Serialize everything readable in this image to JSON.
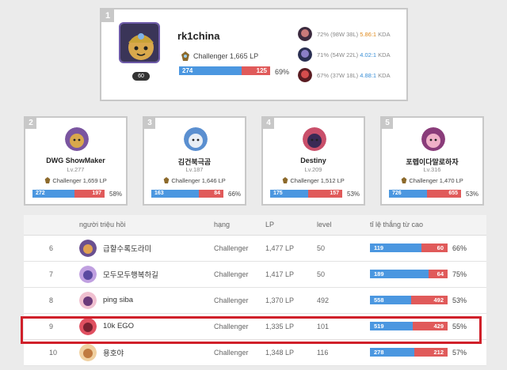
{
  "top1": {
    "rank": "1",
    "name": "rk1china",
    "level": "60",
    "tier": "Challenger",
    "lp": "1,665 LP",
    "wins": "274",
    "losses": "125",
    "win_fraction": 0.69,
    "winrate": "69%",
    "champions": [
      {
        "winrate": "72%",
        "record": "(98W 38L)",
        "kda": "5.86:1",
        "kda_label": "KDA",
        "kda_color": "#e08a1c"
      },
      {
        "winrate": "71%",
        "record": "(54W 22L)",
        "kda": "4.02:1",
        "kda_label": "KDA",
        "kda_color": "#3a8fd6"
      },
      {
        "winrate": "67%",
        "record": "(37W 18L)",
        "kda": "4.88:1",
        "kda_label": "KDA",
        "kda_color": "#3a8fd6"
      }
    ]
  },
  "top_cards": [
    {
      "rank": "2",
      "name": "DWG ShowMaker",
      "level": "Lv.277",
      "tier": "Challenger",
      "lp": "1,659 LP",
      "wins": "272",
      "losses": "197",
      "win_fraction": 0.58,
      "winrate": "58%"
    },
    {
      "rank": "3",
      "name": "김건북극곰",
      "level": "Lv.187",
      "tier": "Challenger",
      "lp": "1,646 LP",
      "wins": "163",
      "losses": "84",
      "win_fraction": 0.66,
      "winrate": "66%"
    },
    {
      "rank": "4",
      "name": "Destiny",
      "level": "Lv.209",
      "tier": "Challenger",
      "lp": "1,512 LP",
      "wins": "175",
      "losses": "157",
      "win_fraction": 0.53,
      "winrate": "53%"
    },
    {
      "rank": "5",
      "name": "포렙이다말로하자",
      "level": "Lv.316",
      "tier": "Challenger",
      "lp": "1,470 LP",
      "wins": "726",
      "losses": "655",
      "win_fraction": 0.53,
      "winrate": "53%"
    }
  ],
  "table": {
    "headers": {
      "summoner": "người triệu hồi",
      "tier": "hạng",
      "lp": "LP",
      "level": "level",
      "winrate": "tỉ lệ thắng từ cao"
    },
    "rows": [
      {
        "rank": "6",
        "name": "급할수록도라미",
        "tier": "Challenger",
        "lp": "1,477 LP",
        "level": "50",
        "wins": "119",
        "losses": "60",
        "win_fraction": 0.66,
        "winrate": "66%"
      },
      {
        "rank": "7",
        "name": "모두모두행복하길",
        "tier": "Challenger",
        "lp": "1,417 LP",
        "level": "50",
        "wins": "189",
        "losses": "64",
        "win_fraction": 0.75,
        "winrate": "75%"
      },
      {
        "rank": "8",
        "name": "ping siba",
        "tier": "Challenger",
        "lp": "1,370 LP",
        "level": "492",
        "wins": "558",
        "losses": "492",
        "win_fraction": 0.53,
        "winrate": "53%"
      },
      {
        "rank": "9",
        "name": "10k EGO",
        "tier": "Challenger",
        "lp": "1,335 LP",
        "level": "101",
        "wins": "519",
        "losses": "429",
        "win_fraction": 0.55,
        "winrate": "55%"
      },
      {
        "rank": "10",
        "name": "용호야",
        "tier": "Challenger",
        "lp": "1,348 LP",
        "level": "116",
        "wins": "278",
        "losses": "212",
        "win_fraction": 0.57,
        "winrate": "57%"
      }
    ]
  },
  "colors": {
    "win": "#4b97e0",
    "loss": "#e05a5a",
    "highlight": "#d0202a"
  }
}
